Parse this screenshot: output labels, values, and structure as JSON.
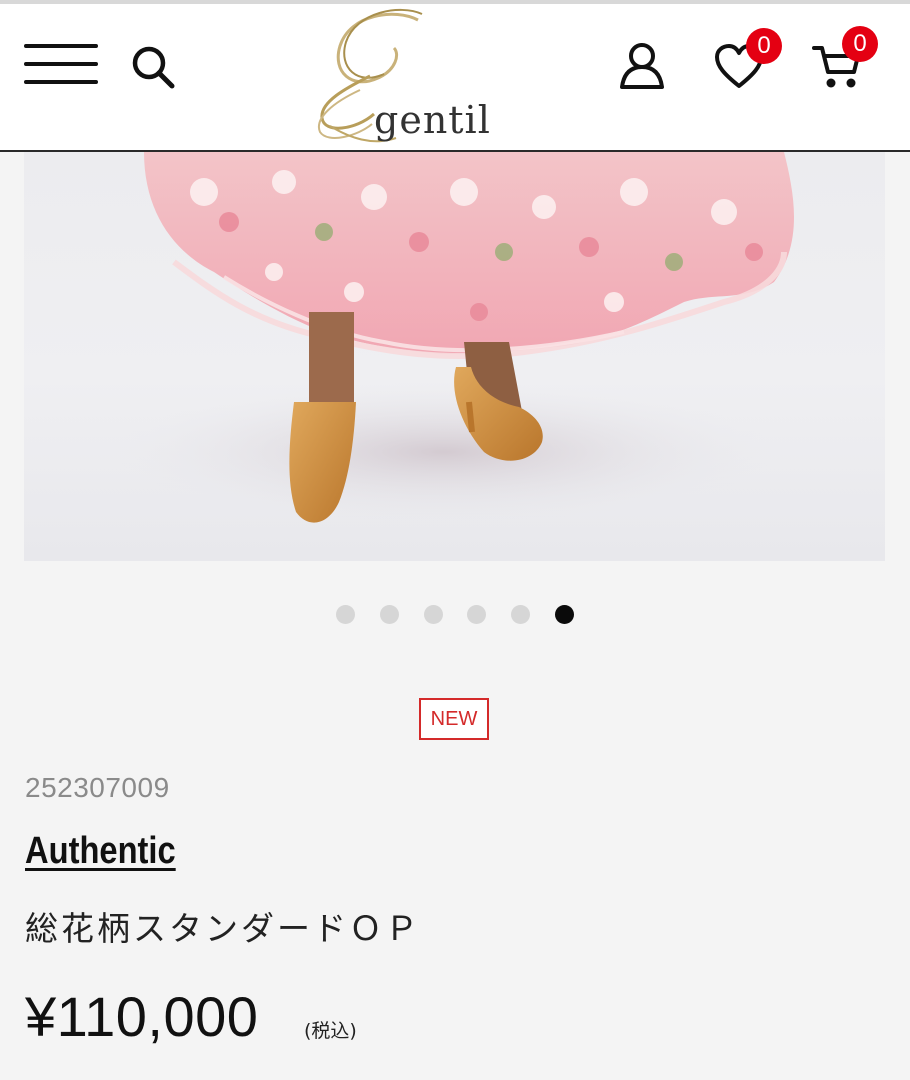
{
  "header": {
    "logo_text": "gentil",
    "wishlist_count": "0",
    "cart_count": "0",
    "badge_color": "#e40012"
  },
  "carousel": {
    "total_slides": 6,
    "active_index": 5
  },
  "product": {
    "badge": "NEW",
    "sku": "252307009",
    "brand": "Authentic",
    "name": "総花柄スタンダードＯＰ",
    "price": "¥110,000",
    "tax_note": "(税込)"
  }
}
